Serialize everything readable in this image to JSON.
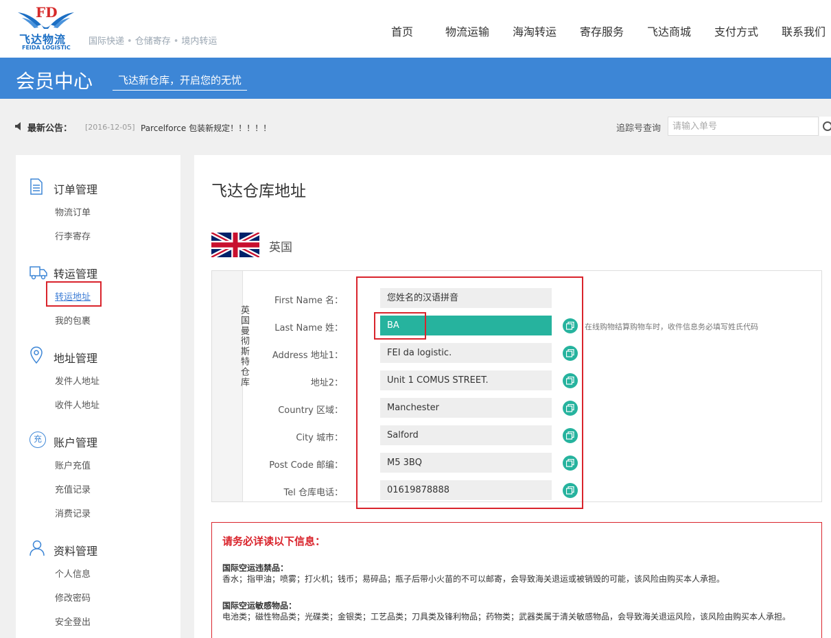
{
  "brand": {
    "logo_mark": "FD",
    "logo_cn": "飞达物流",
    "logo_en": "FEIDA LOGISTIC",
    "slogan_1": "国际快递",
    "slogan_2": "仓储寄存",
    "slogan_3": "境内转运",
    "slogan_dot": "•"
  },
  "nav": [
    {
      "label": "首页"
    },
    {
      "label": "物流运输"
    },
    {
      "label": "海淘转运"
    },
    {
      "label": "寄存服务"
    },
    {
      "label": "飞达商城"
    },
    {
      "label": "支付方式"
    },
    {
      "label": "联系我们"
    }
  ],
  "banner": {
    "title": "会员中心",
    "subtitle": "飞达新仓库，开启您的无忧"
  },
  "notice": {
    "label": "最新公告：",
    "date": "[2016-12-05]",
    "text": "Parcelforce 包装新规定！！！！！"
  },
  "tracking": {
    "label": "追踪号查询",
    "placeholder": "请输入单号"
  },
  "sidebar": {
    "groups": [
      {
        "title": "订单管理",
        "icon": "document-icon",
        "items": [
          {
            "label": "物流订单"
          },
          {
            "label": "行李寄存"
          }
        ]
      },
      {
        "title": "转运管理",
        "icon": "truck-icon",
        "items": [
          {
            "label": "转运地址"
          },
          {
            "label": "我的包裹"
          }
        ]
      },
      {
        "title": "地址管理",
        "icon": "location-pin-icon",
        "items": [
          {
            "label": "发件人地址"
          },
          {
            "label": "收件人地址"
          }
        ]
      },
      {
        "title": "账户管理",
        "icon": "recharge-icon",
        "badge": "充",
        "items": [
          {
            "label": "账户充值"
          },
          {
            "label": "充值记录"
          },
          {
            "label": "消费记录"
          }
        ]
      },
      {
        "title": "资料管理",
        "icon": "user-icon",
        "items": [
          {
            "label": "个人信息"
          },
          {
            "label": "修改密码"
          },
          {
            "label": "安全登出"
          }
        ]
      }
    ],
    "active_item": "转运地址"
  },
  "main": {
    "title": "飞达仓库地址",
    "country": "英国",
    "warehouse_label": "英国曼彻斯特仓库",
    "fields": [
      {
        "label": "First Name 名：",
        "value": "您姓名的汉语拼音",
        "copy": false
      },
      {
        "label": "Last Name 姓：",
        "value": "BA",
        "copy": true,
        "highlight": true
      },
      {
        "label": "Address 地址1：",
        "value": "FEI da logistic.",
        "copy": true
      },
      {
        "label": "地址2：",
        "value": "Unit 1 COMUS STREET.",
        "copy": true
      },
      {
        "label": "Country 区域：",
        "value": "Manchester",
        "copy": true
      },
      {
        "label": "City 城市：",
        "value": "Salford",
        "copy": true
      },
      {
        "label": "Post Code 邮编：",
        "value": "M5 3BQ",
        "copy": true
      },
      {
        "label": "Tel 仓库电话：",
        "value": "01619878888",
        "copy": true
      }
    ],
    "last_name_tip": "在线购物结算购物车时，收件信息务必填写姓氏代码"
  },
  "info": {
    "title": "请务必详读以下信息：",
    "sections": [
      {
        "heading": "国际空运违禁品：",
        "text": "香水；指甲油；喷雾；打火机；钱币；易碎品；瓶子后带小火苗的不可以邮寄，会导致海关退运或被销毁的可能，该风险由购买本人承担。"
      },
      {
        "heading": "国际空运敏感物品：",
        "text": "电池类；磁性物品类；光碟类；金银类；工艺品类；刀具类及锋利物品；药物类；武器类属于清关敏感物品，会导致海关退运风险，该风险由购买本人承担。"
      }
    ]
  },
  "colors": {
    "accent_blue": "#3d86d6",
    "teal": "#26b39e",
    "alert_red": "#d9232b"
  }
}
